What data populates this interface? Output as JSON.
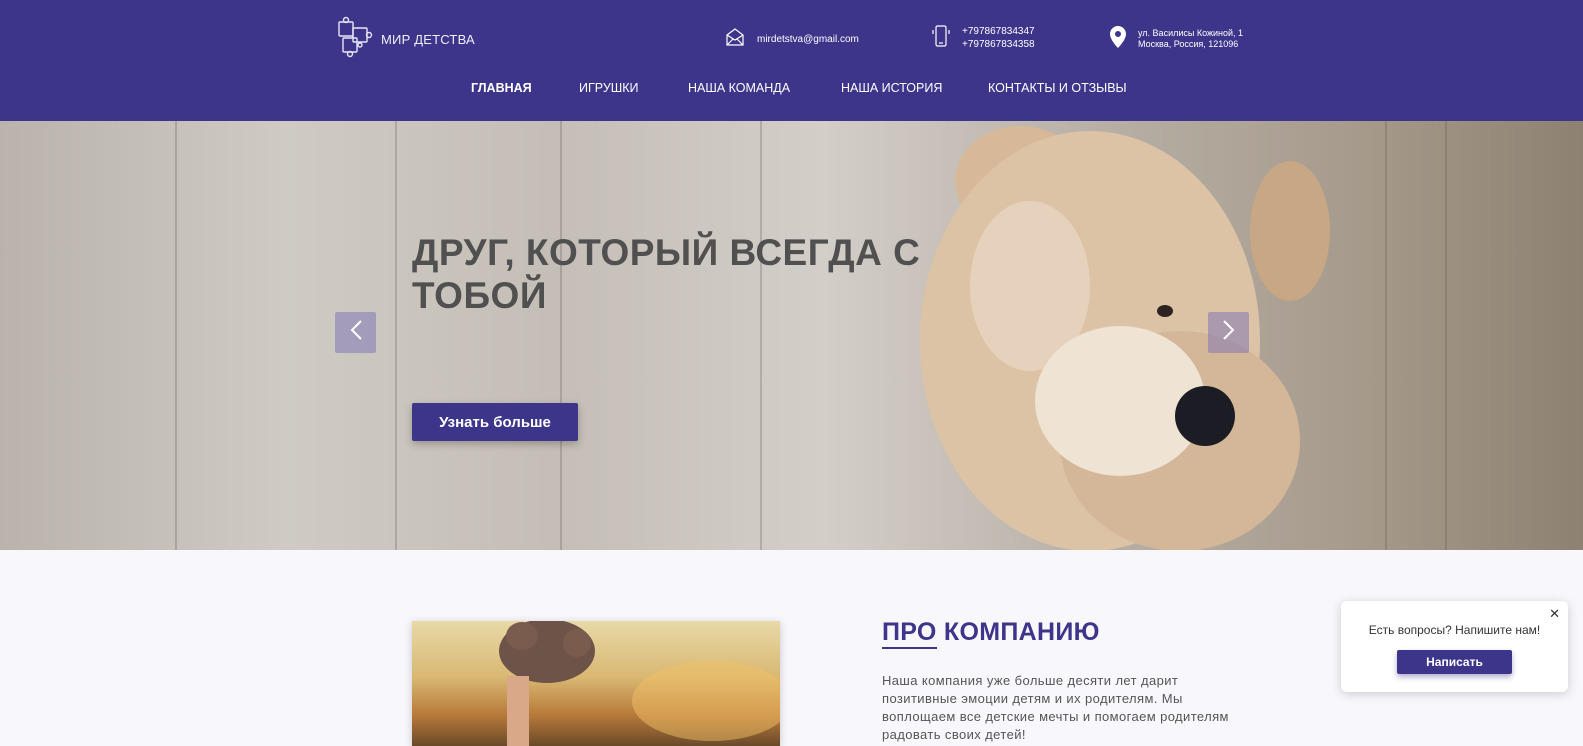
{
  "brand": {
    "name": "МИР ДЕТСТВА"
  },
  "header": {
    "email": "mirdetstva@gmail.com",
    "phones": [
      "+797867834347",
      "+797867834358"
    ],
    "address": [
      "ул. Василисы Кожиной, 1",
      "Москва, Россия, 121096"
    ]
  },
  "nav": {
    "items": [
      {
        "label": "ГЛАВНАЯ"
      },
      {
        "label": "ИГРУШКИ"
      },
      {
        "label": "НАША КОМАНДА"
      },
      {
        "label": "НАША ИСТОРИЯ"
      },
      {
        "label": "КОНТАКТЫ И ОТЗЫВЫ"
      }
    ],
    "active": "ГЛАВНАЯ"
  },
  "hero": {
    "title": "ДРУГ, КОТОРЫЙ ВСЕГДА С ТОБОЙ",
    "button_label": "Узнать больше"
  },
  "about": {
    "title_first": "ПРО",
    "title_rest": " КОМПАНИЮ",
    "text": "Наша компания уже больше десяти лет дарит позитивные эмоции детям и их родителям. Мы воплощаем все детские мечты и помогаем родителям радовать своих детей!"
  },
  "chat": {
    "text": "Есть вопросы? Напишите нам!",
    "button_label": "Написать",
    "close": "✕"
  },
  "colors": {
    "brand": "#3d358a",
    "white": "#ffffff"
  },
  "icons": [
    "puzzle-logo-icon",
    "mail-icon",
    "phone-icon",
    "location-pin-icon",
    "chevron-left-icon",
    "chevron-right-icon",
    "close-icon"
  ]
}
